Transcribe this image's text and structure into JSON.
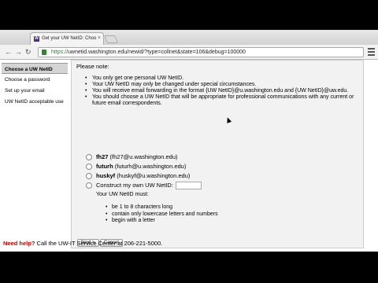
{
  "browser": {
    "tab_title": "Get your UW NetID: Choo",
    "tab_favicon": "W",
    "tab_close": "×",
    "url_scheme": "https://",
    "url_rest": "uwnetid.washington.edu/newid/?type=collnet&state=106&debug=100000",
    "back_icon": "←",
    "forward_icon": "→",
    "reload_icon": "↻"
  },
  "sidebar": {
    "items": [
      {
        "label": "Choose a UW NetID",
        "active": true
      },
      {
        "label": "Choose a password",
        "active": false
      },
      {
        "label": "Set up your email",
        "active": false
      },
      {
        "label": "UW NetID acceptable use",
        "active": false
      }
    ]
  },
  "main": {
    "heading": "Please note:",
    "notes": [
      "You only get one personal UW NetID.",
      "Your UW NetID may only be changed under special circumstances.",
      "You will receive email forwarding in the format {UW NetID}@u.washington.edu and {UW NetID}@uw.edu.",
      "You should choose a UW NetID that will be appropriate for professional communications with any current or future email correspondents."
    ],
    "options": [
      {
        "id": "fh27",
        "email": "(fh27@u.washington.edu)"
      },
      {
        "id": "futurh",
        "email": "(futurh@u.washington.edu)"
      },
      {
        "id": "huskyf",
        "email": "(huskyf@u.washington.edu)"
      }
    ],
    "own_label": "Construct my own UW NetID:",
    "must_heading": "Your UW NetID must:",
    "rules": [
      "be 1 to 8 characters long",
      "contain only lowercase letters and numbers",
      "begin with a letter"
    ],
    "next_button": "Next >",
    "cancel_button": "Cancel"
  },
  "footer": {
    "help_link": "Need help?",
    "help_text": " Call the UW-IT Service Center at 206-221-5000."
  }
}
